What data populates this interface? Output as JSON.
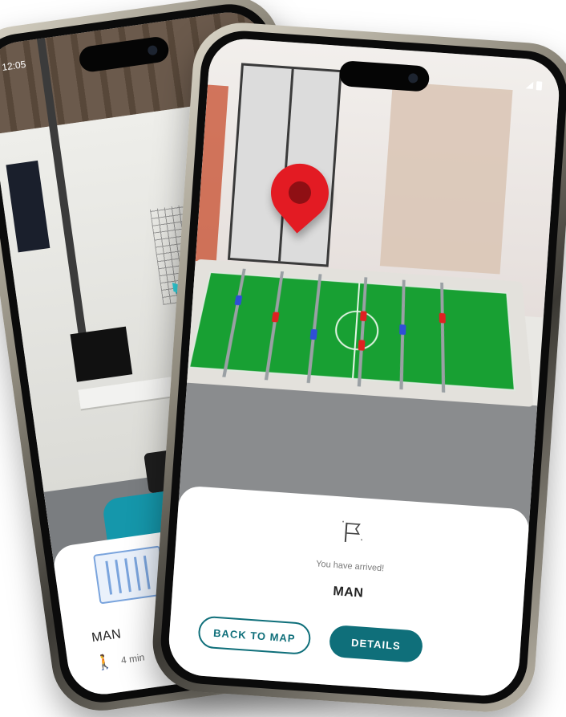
{
  "back_phone": {
    "status_time": "12:05",
    "card": {
      "destination": "MAN",
      "walk_time": "4 min"
    }
  },
  "front_phone": {
    "card": {
      "arrived_text": "You have arrived!",
      "destination": "MAN",
      "back_to_map_label": "BACK TO MAP",
      "details_label": "DETAILS"
    }
  },
  "colors": {
    "accent": "#0f6f7a",
    "pin": "#e31b23",
    "ar_arrow": "#2fd5e0",
    "map_outline": "#7aa4dd"
  },
  "icons": [
    "walk-icon",
    "flag-icon",
    "location-pin-icon",
    "ar-arrow-icon",
    "map-thumbnail-icon"
  ]
}
